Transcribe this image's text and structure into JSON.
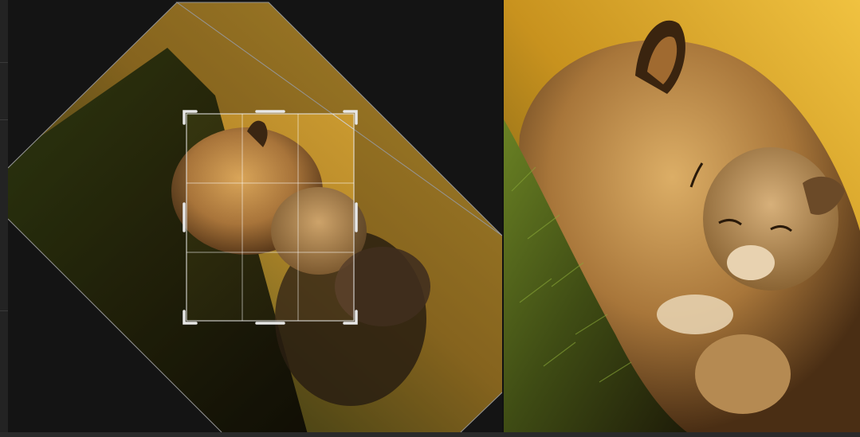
{
  "colors": {
    "workspace": "#1c1c1c",
    "gutter": "#232323",
    "crop_overlay_dim": "#000000",
    "crop_handle": "#e8e8e8",
    "grid_line": "#ffffff",
    "photo_background_warm": "#e8b33a",
    "photo_grass": "#5a6a1e",
    "lion_fur": "#b0803c"
  },
  "editor": {
    "rotation_degrees": 45,
    "grid_divisions": 3,
    "mode": "crop"
  },
  "icons": {
    "crop_handle_corner": "corner-bracket",
    "crop_handle_edge": "edge-bar"
  }
}
